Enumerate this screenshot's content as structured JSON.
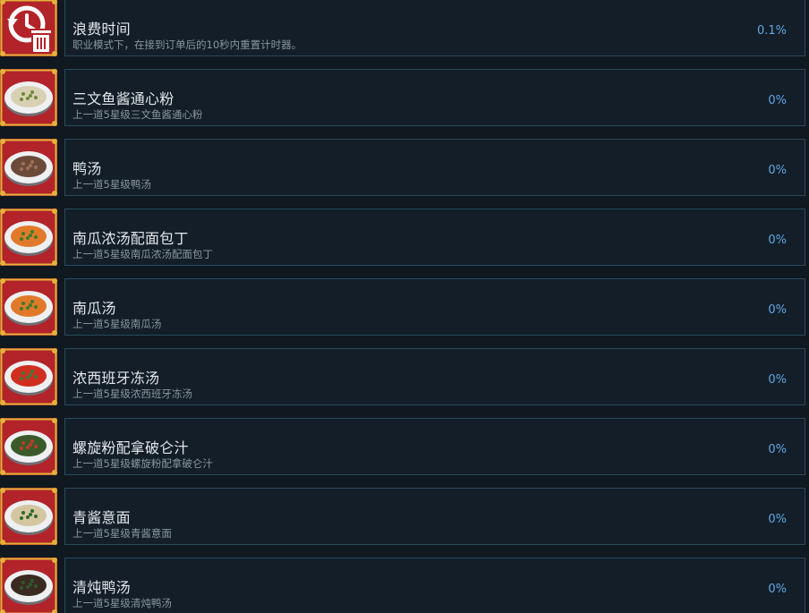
{
  "achievements": [
    {
      "title": "浪费时间",
      "desc": "职业模式下，在接到订单后的10秒内重置计时器。",
      "percent": "0.1%",
      "icon": "clock-reset-trash-icon",
      "food": "#d9d9d9",
      "sauce": "#c7c7c7"
    },
    {
      "title": "三文鱼酱通心粉",
      "desc": "上一道5星级三文鱼酱通心粉",
      "percent": "0%",
      "icon": "salmon-macaroni-dish-icon",
      "food": "#d8d0b3",
      "sauce": "#6f8a3a"
    },
    {
      "title": "鸭汤",
      "desc": "上一道5星级鸭汤",
      "percent": "0%",
      "icon": "duck-soup-dish-icon",
      "food": "#6b4a3a",
      "sauce": "#a0705a"
    },
    {
      "title": "南瓜浓汤配面包丁",
      "desc": "上一道5星级南瓜浓汤配面包丁",
      "percent": "0%",
      "icon": "pumpkin-soup-croutons-dish-icon",
      "food": "#e07a2a",
      "sauce": "#3f7a2a"
    },
    {
      "title": "南瓜汤",
      "desc": "上一道5星级南瓜汤",
      "percent": "0%",
      "icon": "pumpkin-soup-dish-icon",
      "food": "#e07a2a",
      "sauce": "#3f7a2a"
    },
    {
      "title": "浓西班牙冻汤",
      "desc": "上一道5星级浓西班牙冻汤",
      "percent": "0%",
      "icon": "gazpacho-dish-icon",
      "food": "#cf2e20",
      "sauce": "#3e7a3a"
    },
    {
      "title": "螺旋粉配拿破仑汁",
      "desc": "上一道5星级螺旋粉配拿破仑汁",
      "percent": "0%",
      "icon": "fusilli-napolitana-dish-icon",
      "food": "#3a5a2a",
      "sauce": "#c23a2a"
    },
    {
      "title": "青酱意面",
      "desc": "上一道5星级青酱意面",
      "percent": "0%",
      "icon": "pesto-pasta-dish-icon",
      "food": "#d3c6a0",
      "sauce": "#2f6a2a"
    },
    {
      "title": "清炖鸭汤",
      "desc": "上一道5星级清炖鸭汤",
      "percent": "0%",
      "icon": "consomme-duck-soup-dish-icon",
      "food": "#3a2a22",
      "sauce": "#2f5a2a"
    }
  ],
  "colors": {
    "background": "#101820",
    "card": "#131e29",
    "card_border": "#2a4a5c",
    "title": "#e3e7ea",
    "desc": "#8a96a0",
    "percent": "#62a7e3",
    "badge_red": "#b2232a",
    "badge_gold": "#e2b23a"
  }
}
